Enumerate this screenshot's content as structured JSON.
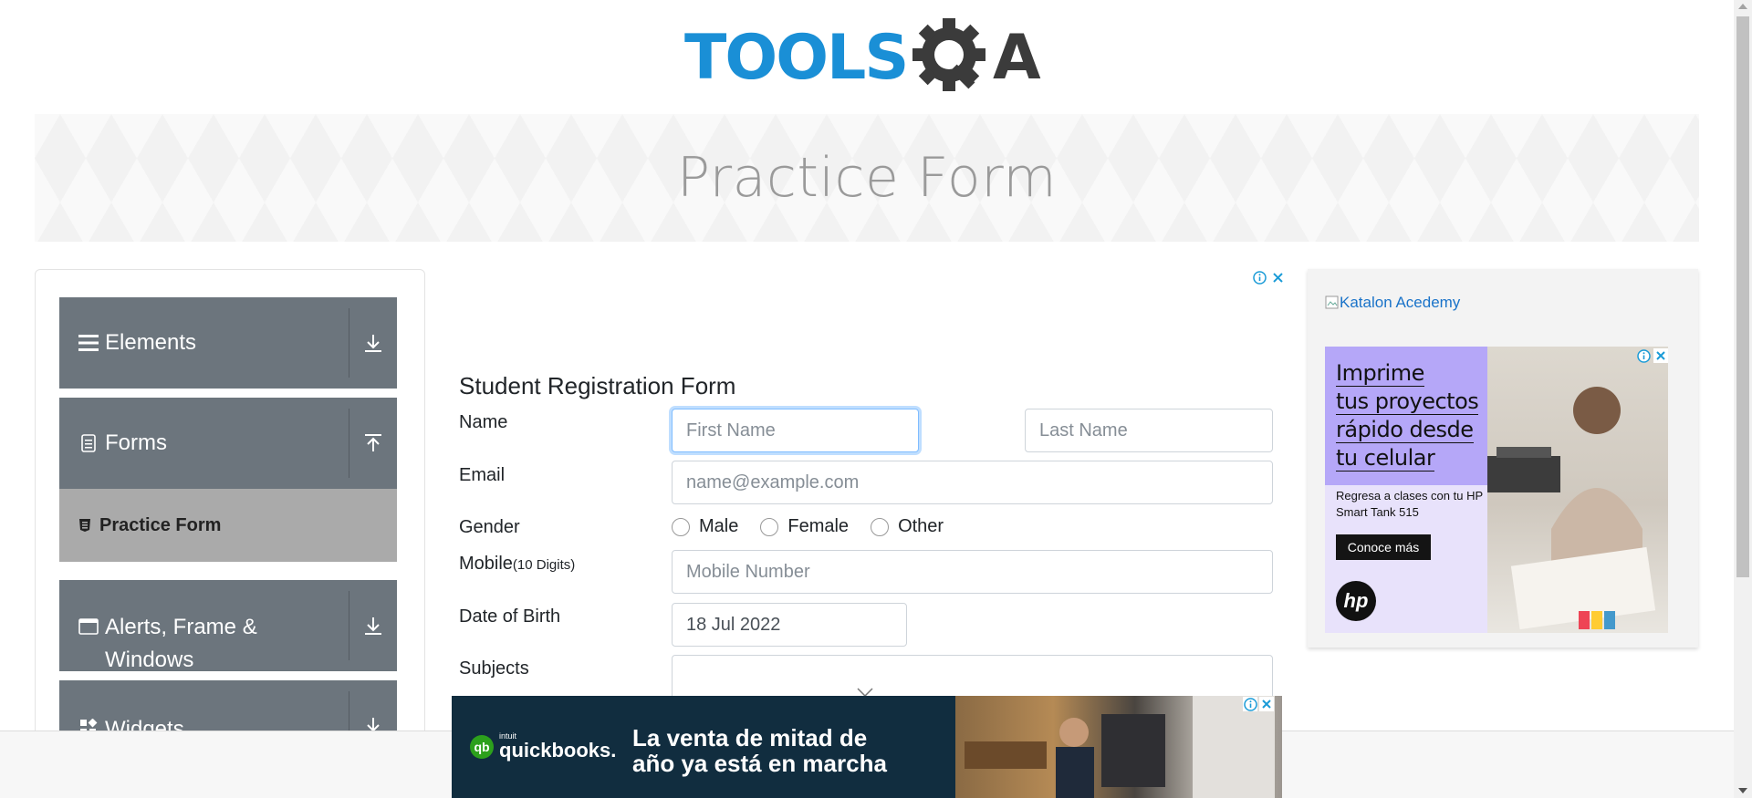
{
  "logo": {
    "text_left": "TOOLS",
    "text_right": "A"
  },
  "banner": {
    "title": "Practice Form"
  },
  "sidebar": {
    "groups": [
      {
        "label": "Elements",
        "icon": "hamburger-icon",
        "arrow": "download-arrow-icon"
      },
      {
        "label": "Forms",
        "icon": "document-icon",
        "arrow": "upload-arrow-icon"
      },
      {
        "label": "Alerts, Frame &",
        "label2": "Windows",
        "icon": "window-icon",
        "arrow": "download-arrow-icon"
      },
      {
        "label": "Widgets",
        "icon": "widgets-icon",
        "arrow": "download-arrow-icon"
      }
    ],
    "active_item": {
      "label": "Practice Form",
      "icon": "form-badge-icon"
    }
  },
  "form": {
    "title": "Student Registration Form",
    "name_label": "Name",
    "first_name_placeholder": "First Name",
    "last_name_placeholder": "Last Name",
    "email_label": "Email",
    "email_placeholder": "name@example.com",
    "gender_label": "Gender",
    "gender_options": [
      "Male",
      "Female",
      "Other"
    ],
    "mobile_label": "Mobile",
    "mobile_hint": "(10 Digits)",
    "mobile_placeholder": "Mobile Number",
    "dob_label": "Date of Birth",
    "dob_value": "18 Jul 2022",
    "subjects_label": "Subjects"
  },
  "right_ad": {
    "link_text": "Katalon Acedemy",
    "headline": [
      "Imprime",
      "tus proyectos",
      "rápido desde",
      "tu celular"
    ],
    "sub": "Regresa a clases con tu HP Smart Tank 515",
    "button": "Conoce más",
    "brand": "hp"
  },
  "bottom_ad": {
    "brand_small": "intuit",
    "brand": "quickbooks.",
    "line1": "La venta de mitad de",
    "line2": "año ya está en marcha"
  },
  "colors": {
    "logo_blue": "#1a8fd6",
    "logo_dark": "#3b3b3b",
    "sidebar_group": "#6c757d",
    "sidebar_active": "#aaaaaa",
    "focus_border": "#80bdff"
  }
}
